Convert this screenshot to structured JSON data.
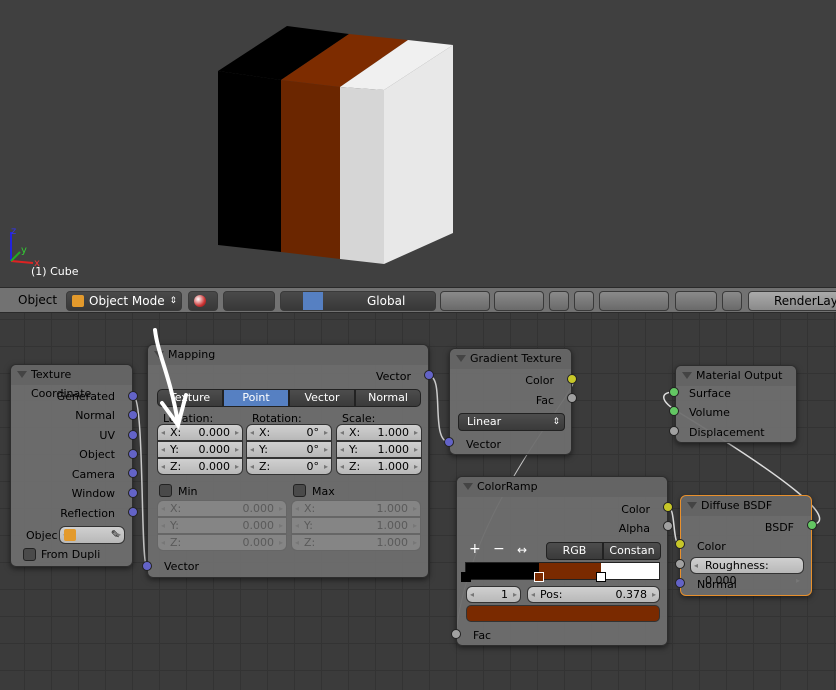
{
  "viewport": {
    "object_label": "(1) Cube",
    "axes": [
      "x",
      "y",
      "z"
    ],
    "cube_colors": {
      "black": "#000000",
      "orange": "#6b2600",
      "white": "#e0e0e0"
    }
  },
  "header": {
    "editor_type": "Object",
    "mode": "Object Mode",
    "orientation": "Global",
    "render_layer": "RenderLaye"
  },
  "nodes": {
    "texcoord": {
      "title": "Texture Coordinate",
      "outputs": [
        "Generated",
        "Normal",
        "UV",
        "Object",
        "Camera",
        "Window",
        "Reflection"
      ],
      "object_label": "Objec",
      "from_dupli": "From Dupli"
    },
    "mapping": {
      "title": "Mapping",
      "output": "Vector",
      "input": "Vector",
      "tabs": [
        "Texture",
        "Point",
        "Vector",
        "Normal"
      ],
      "active_tab": "Point",
      "location_label": "Location:",
      "rotation_label": "Rotation:",
      "scale_label": "Scale:",
      "location": [
        {
          "axis": "X:",
          "value": "0.000"
        },
        {
          "axis": "Y:",
          "value": "0.000"
        },
        {
          "axis": "Z:",
          "value": "0.000"
        }
      ],
      "rotation": [
        {
          "axis": "X:",
          "value": "0°"
        },
        {
          "axis": "Y:",
          "value": "0°"
        },
        {
          "axis": "Z:",
          "value": "0°"
        }
      ],
      "scale": [
        {
          "axis": "X:",
          "value": "1.000"
        },
        {
          "axis": "Y:",
          "value": "1.000"
        },
        {
          "axis": "Z:",
          "value": "1.000"
        }
      ],
      "min_label": "Min",
      "max_label": "Max",
      "min": [
        {
          "axis": "X:",
          "value": "0.000"
        },
        {
          "axis": "Y:",
          "value": "0.000"
        },
        {
          "axis": "Z:",
          "value": "0.000"
        }
      ],
      "max": [
        {
          "axis": "X:",
          "value": "1.000"
        },
        {
          "axis": "Y:",
          "value": "1.000"
        },
        {
          "axis": "Z:",
          "value": "1.000"
        }
      ]
    },
    "gradient": {
      "title": "Gradient Texture",
      "outputs": [
        "Color",
        "Fac"
      ],
      "type": "Linear",
      "input": "Vector"
    },
    "colorramp": {
      "title": "ColorRamp",
      "outputs": [
        "Color",
        "Alpha"
      ],
      "color_mode": "RGB",
      "interpolation": "Constan",
      "add": "+",
      "remove": "−",
      "flip": "↔",
      "index": "1",
      "pos_label": "Pos:",
      "pos": "0.378",
      "input": "Fac",
      "stops": [
        {
          "pos": 0.0,
          "color": "#000000"
        },
        {
          "pos": 0.378,
          "color": "#7a2a00"
        },
        {
          "pos": 0.7,
          "color": "#ffffff"
        }
      ],
      "active_color": "#7a2a00"
    },
    "output": {
      "title": "Material Output",
      "inputs": [
        "Surface",
        "Volume",
        "Displacement"
      ]
    },
    "diffuse": {
      "title": "Diffuse BSDF",
      "output": "BSDF",
      "color_label": "Color",
      "roughness": "Roughness:  0.000",
      "normal": "Normal"
    }
  }
}
